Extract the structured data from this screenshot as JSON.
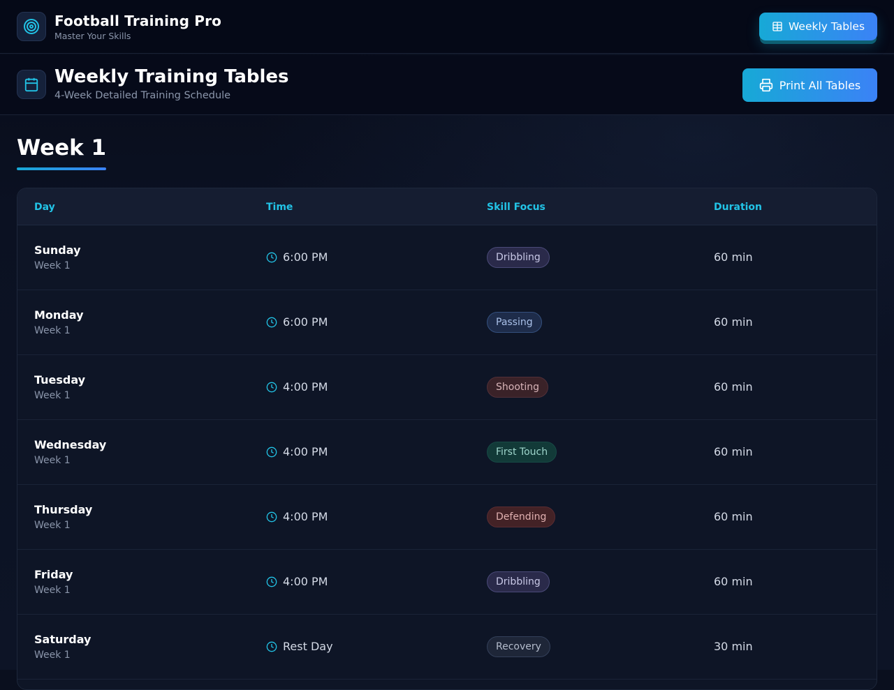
{
  "app": {
    "title": "Football Training Pro",
    "subtitle": "Master Your Skills",
    "logo_icon": "target-icon",
    "nav_button_label": "Weekly Tables",
    "nav_button_icon": "table-icon"
  },
  "page": {
    "title": "Weekly Training Tables",
    "subtitle": "4-Week Detailed Training Schedule",
    "header_icon": "calendar-icon",
    "print_button_label": "Print All Tables",
    "print_button_icon": "printer-icon"
  },
  "week": {
    "title": "Week 1"
  },
  "table": {
    "columns": [
      "Day",
      "Time",
      "Skill Focus",
      "Duration"
    ],
    "rows": [
      {
        "day": "Sunday",
        "week": "Week 1",
        "time": "6:00 PM",
        "skill": "Dribbling",
        "duration": "60 min"
      },
      {
        "day": "Monday",
        "week": "Week 1",
        "time": "6:00 PM",
        "skill": "Passing",
        "duration": "60 min"
      },
      {
        "day": "Tuesday",
        "week": "Week 1",
        "time": "4:00 PM",
        "skill": "Shooting",
        "duration": "60 min"
      },
      {
        "day": "Wednesday",
        "week": "Week 1",
        "time": "4:00 PM",
        "skill": "First Touch",
        "duration": "60 min"
      },
      {
        "day": "Thursday",
        "week": "Week 1",
        "time": "4:00 PM",
        "skill": "Defending",
        "duration": "60 min"
      },
      {
        "day": "Friday",
        "week": "Week 1",
        "time": "4:00 PM",
        "skill": "Dribbling",
        "duration": "60 min"
      },
      {
        "day": "Saturday",
        "week": "Week 1",
        "time": "Rest Day",
        "skill": "Recovery",
        "duration": "30 min"
      }
    ]
  },
  "colors": {
    "accent": "#22c3e6",
    "accent_gradient_start": "#17a9d6",
    "accent_gradient_end": "#3b82f6",
    "background": "#0a0f1e",
    "skill_badges": {
      "Dribbling": {
        "bg": "#2a2a4a",
        "border": "#4a4a78",
        "text": "#c8c8e6"
      },
      "Passing": {
        "bg": "#1e2c4a",
        "border": "#34507e",
        "text": "#a9c0e8"
      },
      "Shooting": {
        "bg": "#3a2228",
        "border": "#523038",
        "text": "#d8b4b8"
      },
      "First Touch": {
        "bg": "#123a38",
        "border": "#174a46",
        "text": "#9fd6cc"
      },
      "Defending": {
        "bg": "#432226",
        "border": "#5a2c32",
        "text": "#e0b0b0"
      },
      "Recovery": {
        "bg": "#1e2638",
        "border": "#34405a",
        "text": "#b4bccc"
      }
    }
  }
}
